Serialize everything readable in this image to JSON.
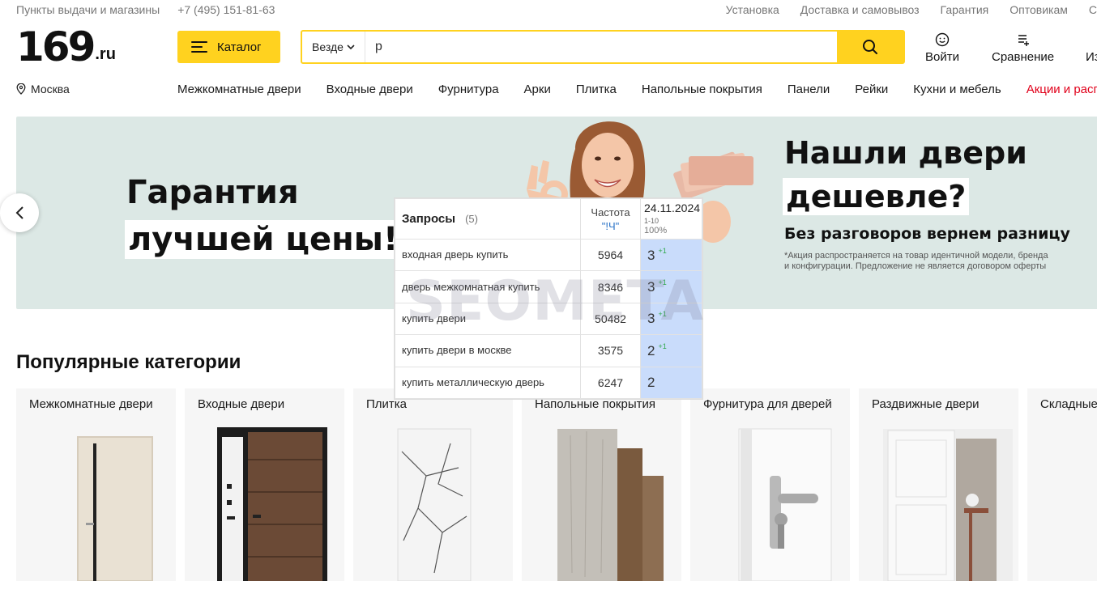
{
  "topbar": {
    "pickup": "Пункты выдачи и магазины",
    "phone": "+7 (495) 151-81-63",
    "links": [
      "Установка",
      "Доставка и самовывоз",
      "Гарантия",
      "Оптовикам",
      "С"
    ]
  },
  "header": {
    "logo_num": "169",
    "logo_tld": ".ru",
    "catalog_label": "Каталог",
    "search_scope": "Везде",
    "search_value": "p",
    "login_label": "Войти",
    "compare_label": "Сравнение",
    "fav_label": "Из"
  },
  "city": "Москва",
  "nav": [
    "Межкомнатные двери",
    "Входные двери",
    "Фурнитура",
    "Арки",
    "Плитка",
    "Напольные покрытия",
    "Панели",
    "Рейки",
    "Кухни и мебель",
    "Акции и распрод"
  ],
  "banner": {
    "left_line1": "Гарантия",
    "left_line2": "лучшей цены!",
    "right_line1": "Нашли двери",
    "right_line2": "дешевле?",
    "right_sub": "Без разговоров вернем разницу",
    "fine_print": "*Акция распространяется на товар идентичной модели, бренда и конфигурации. Предложение не является договором оферты"
  },
  "categories_title": "Популярные категории",
  "categories": [
    "Межкомнатные двери",
    "Входные двери",
    "Плитка",
    "Напольные покрытия",
    "Фурнитура для дверей",
    "Раздвижные двери",
    "Складные"
  ],
  "seo": {
    "title": "Запросы",
    "count": "(5)",
    "freq_label": "Частота",
    "freq_sub": "\"!Ч\"",
    "date": "24.11.2024",
    "range": "1-10",
    "percent": "100%",
    "watermark": "SEOMETA",
    "rows": [
      {
        "q": "входная дверь купить",
        "f": "5964",
        "p": "3",
        "d": "+1"
      },
      {
        "q": "дверь межкомнатная купить",
        "f": "8346",
        "p": "3",
        "d": "+1"
      },
      {
        "q": "купить двери",
        "f": "50482",
        "p": "3",
        "d": "+1"
      },
      {
        "q": "купить двери в москве",
        "f": "3575",
        "p": "2",
        "d": "+1"
      },
      {
        "q": "купить металлическую дверь",
        "f": "6247",
        "p": "2",
        "d": ""
      }
    ]
  },
  "colors": {
    "accent": "#ffd21f",
    "sale": "#e1001a",
    "banner_bg": "#dce8e5",
    "position_bg": "#c9dcfb"
  }
}
